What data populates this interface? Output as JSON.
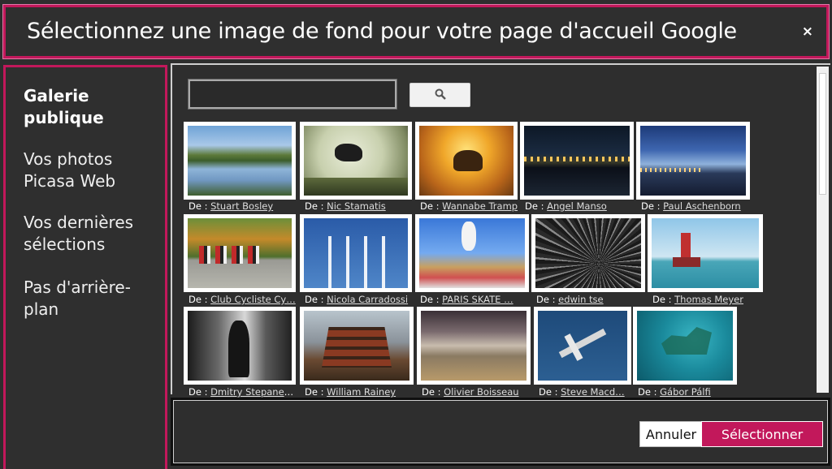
{
  "dialog": {
    "title": "Sélectionnez une image de fond pour votre page d'accueil Google",
    "close_label": "×"
  },
  "sidebar": {
    "items": [
      {
        "label": "Galerie publique",
        "active": true
      },
      {
        "label": "Vos photos Picasa Web",
        "active": false
      },
      {
        "label": "Vos dernières sélections",
        "active": false
      },
      {
        "label": "Pas d'arrière-plan",
        "active": false
      }
    ]
  },
  "search": {
    "value": "",
    "placeholder": "",
    "button_icon": "search-icon"
  },
  "gallery": {
    "credit_prefix": "De : ",
    "photos": [
      {
        "author": "Stuart Bosley",
        "subject": "mountain-lake"
      },
      {
        "author": "Nic Stamatis",
        "subject": "motocross-jump"
      },
      {
        "author": "Wannabe Tramp",
        "subject": "elephant-sunset"
      },
      {
        "author": "Angel Manso",
        "subject": "city-bridge-night"
      },
      {
        "author": "Paul Aschenborn",
        "subject": "coast-dusk"
      },
      {
        "author": "Club Cycliste Cy…",
        "subject": "cyclists"
      },
      {
        "author": "Nicola Carradossi",
        "subject": "jets-formation"
      },
      {
        "author": "PARIS SKATE …",
        "subject": "skater"
      },
      {
        "author": "edwin tse",
        "subject": "abstract-rays"
      },
      {
        "author": "Thomas Meyer",
        "subject": "lighthouse"
      },
      {
        "author": "Dmitry Stepanenko",
        "subject": "street-bw"
      },
      {
        "author": "William Rainey",
        "subject": "pagoda"
      },
      {
        "author": "Olivier Boisseau",
        "subject": "beach-sky"
      },
      {
        "author": "Steve Macd…",
        "subject": "aircraft-sea"
      },
      {
        "author": "Gábor Pálfi",
        "subject": "shipwreck"
      }
    ]
  },
  "footer": {
    "cancel_label": "Annuler",
    "select_label": "Sélectionner"
  },
  "colors": {
    "accent": "#c2185b",
    "background": "#2e2e2e",
    "text": "#ffffff"
  }
}
